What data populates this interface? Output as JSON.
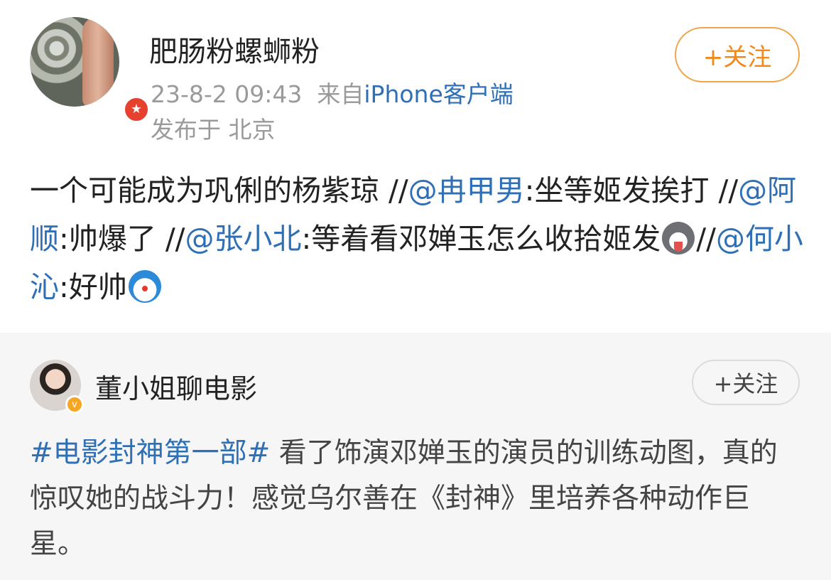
{
  "post": {
    "username": "肥肠粉螺蛳粉",
    "time": "23-8-2 09:43",
    "source_prefix": "来自",
    "source": "iPhone客户端",
    "location": "发布于 北京",
    "follow_label": "+关注",
    "text_segments": {
      "t1": "一个可能成为巩俐的杨紫琼 //",
      "m1": "@冉甲男",
      "t2": ":坐等姬发挨打 //",
      "m2": "@阿顺",
      "t3": ":帅爆了 //",
      "m3": "@张小北",
      "t4": ":等着看邓婵玉怎么收拾姬发",
      "e1": "husky-emoji",
      "t5": "//",
      "m4": "@何小沁",
      "t6": ":好帅",
      "e2": "doraemon-emoji"
    }
  },
  "repost": {
    "username": "董小姐聊电影",
    "follow_label": "+关注",
    "hashtag": "#电影封神第一部#",
    "text": " 看了饰演邓婵玉的演员的训练动图，真的惊叹她的战斗力！感觉乌尔善在《封神》里培养各种动作巨星。"
  },
  "colors": {
    "link_blue": "#2e6fb5",
    "follow_orange": "#f08a1c",
    "badge_red": "#e6402e",
    "badge_orange": "#f5a623",
    "repost_bg": "#f6f6f6"
  }
}
